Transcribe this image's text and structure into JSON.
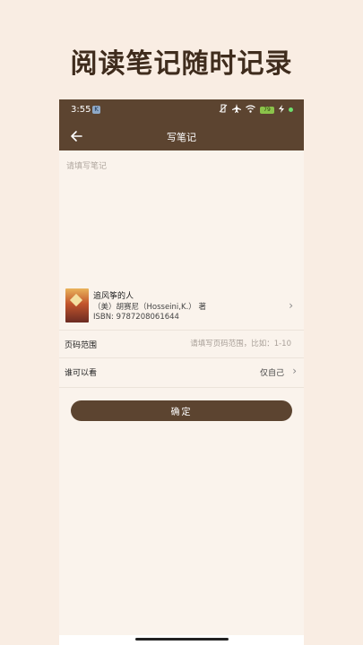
{
  "promo": {
    "title": "阅读笔记随时记录"
  },
  "status_bar": {
    "time": "3:55",
    "battery": "79"
  },
  "nav": {
    "title": "写笔记"
  },
  "note": {
    "placeholder": "请填写笔记"
  },
  "book": {
    "title": "追风筝的人",
    "author": "（美）胡赛尼（Hosseini,K.） 著",
    "isbn": "ISBN: 9787208061644"
  },
  "page_range": {
    "label": "页码范围",
    "placeholder": "请填写页码范围，比如：1-10"
  },
  "visibility": {
    "label": "谁可以看",
    "value": "仅自己"
  },
  "confirm": {
    "label": "确定"
  },
  "colors": {
    "brand": "#5c4430",
    "background": "#f9ede3"
  }
}
